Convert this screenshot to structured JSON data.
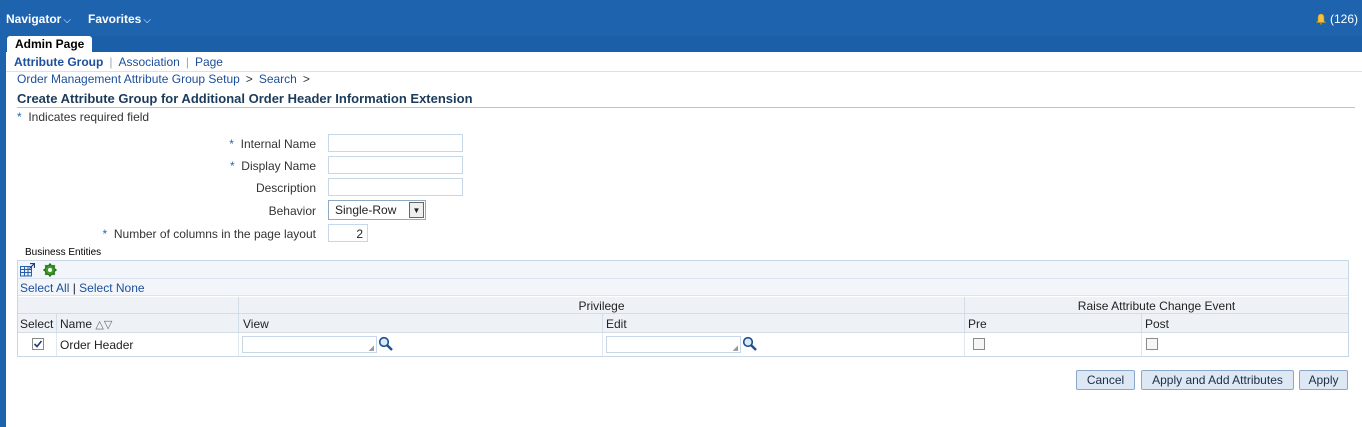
{
  "topbar": {
    "navigator": "Navigator",
    "favorites": "Favorites",
    "notifications": "(126)",
    "caret": "⌵"
  },
  "tab": {
    "label": "Admin Page"
  },
  "subnav": {
    "items": [
      "Attribute Group",
      "Association",
      "Page"
    ],
    "separator": "|"
  },
  "breadcrumbs": [
    "Order Management Attribute Group Setup",
    "Search"
  ],
  "breadcrumb_sep": ">",
  "page": {
    "title": "Create Attribute Group for Additional Order Header Information Extension",
    "required_note": "Indicates required field",
    "star": "*"
  },
  "form": {
    "internal_name_label": "Internal Name",
    "display_name_label": "Display Name",
    "description_label": "Description",
    "behavior_label": "Behavior",
    "behavior_value": "Single-Row",
    "columns_label": "Number of columns in the page layout",
    "columns_value": "2"
  },
  "business_entities": {
    "label": "Business Entities",
    "select_all": "Select All",
    "select_sep": "|",
    "select_none": "Select None",
    "headers": {
      "select": "Select",
      "name": "Name",
      "privilege": "Privilege",
      "view": "View",
      "edit": "Edit",
      "raise_event": "Raise Attribute Change Event",
      "pre": "Pre",
      "post": "Post"
    },
    "rows": [
      {
        "selected": true,
        "name": "Order Header",
        "pre": false,
        "post": false
      }
    ]
  },
  "buttons": {
    "cancel": "Cancel",
    "apply_add": "Apply and Add Attributes",
    "apply": "Apply"
  }
}
